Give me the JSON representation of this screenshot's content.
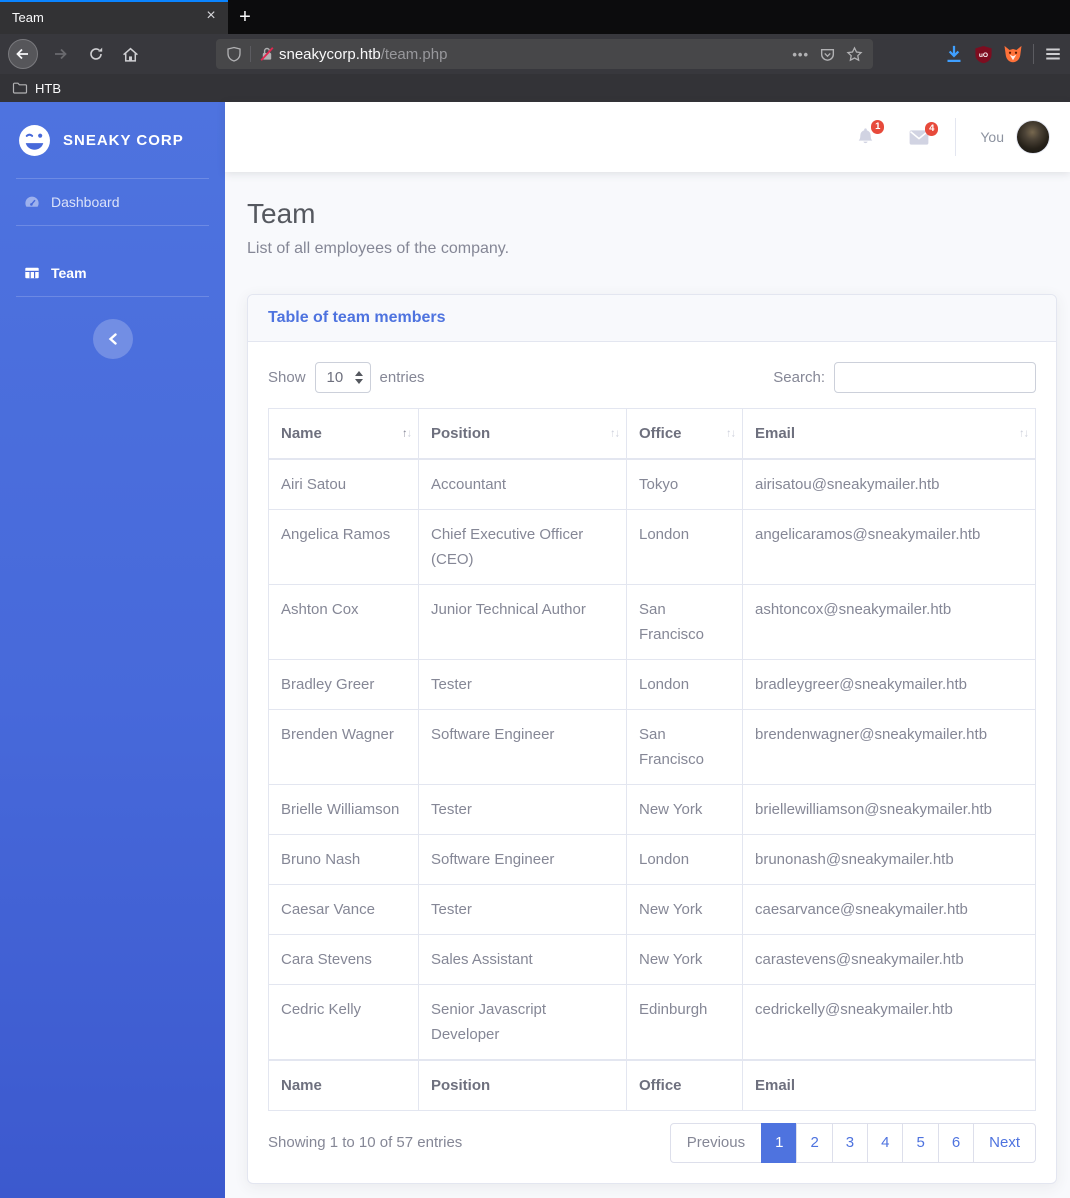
{
  "colors": {
    "primary": "#4e73df",
    "badge": "#e74a3b",
    "tab_accent": "#0a84ff"
  },
  "browser": {
    "tab_title": "Team",
    "close_glyph": "×",
    "new_tab_glyph": "+",
    "url_host": "sneakycorp.htb",
    "url_path": "/team.php",
    "page_actions_glyph": "•••",
    "bookmark_label": "HTB",
    "icons": [
      "back-icon",
      "forward-icon",
      "reload-icon",
      "home-icon",
      "shield-icon",
      "insecure-lock-icon",
      "pocket-icon",
      "bookmark-star-icon",
      "download-icon",
      "ublock-icon",
      "foxyproxy-icon",
      "menu-icon",
      "folder-icon"
    ]
  },
  "sidebar": {
    "brand": "SNEAKY CORP",
    "items": [
      {
        "label": "Dashboard",
        "icon": "dashboard-icon",
        "active": false
      },
      {
        "label": "Team",
        "icon": "table-icon",
        "active": true
      }
    ]
  },
  "topbar": {
    "alerts_badge": "1",
    "messages_badge": "4",
    "user_label": "You"
  },
  "page": {
    "heading": "Team",
    "subheading": "List of all employees of the company."
  },
  "card": {
    "title": "Table of team members",
    "length_control": {
      "show_label": "Show",
      "entries_label": "entries",
      "value": "10"
    },
    "search": {
      "label": "Search:",
      "value": ""
    },
    "table": {
      "columns": [
        "Name",
        "Position",
        "Office",
        "Email"
      ],
      "sorted_column": "Name",
      "sorted_dir": "asc",
      "sort_asc_glyph": "↑",
      "sort_desc_glyph": "↓",
      "rows": [
        [
          "Airi Satou",
          "Accountant",
          "Tokyo",
          "airisatou@sneakymailer.htb"
        ],
        [
          "Angelica Ramos",
          "Chief Executive Officer (CEO)",
          "London",
          "angelicaramos@sneakymailer.htb"
        ],
        [
          "Ashton Cox",
          "Junior Technical Author",
          "San Francisco",
          "ashtoncox@sneakymailer.htb"
        ],
        [
          "Bradley Greer",
          "Tester",
          "London",
          "bradleygreer@sneakymailer.htb"
        ],
        [
          "Brenden Wagner",
          "Software Engineer",
          "San Francisco",
          "brendenwagner@sneakymailer.htb"
        ],
        [
          "Brielle Williamson",
          "Tester",
          "New York",
          "briellewilliamson@sneakymailer.htb"
        ],
        [
          "Bruno Nash",
          "Software Engineer",
          "London",
          "brunonash@sneakymailer.htb"
        ],
        [
          "Caesar Vance",
          "Tester",
          "New York",
          "caesarvance@sneakymailer.htb"
        ],
        [
          "Cara Stevens",
          "Sales Assistant",
          "New York",
          "carastevens@sneakymailer.htb"
        ],
        [
          "Cedric Kelly",
          "Senior Javascript Developer",
          "Edinburgh",
          "cedrickelly@sneakymailer.htb"
        ]
      ]
    },
    "info": "Showing 1 to 10 of 57 entries",
    "pagination": {
      "previous": "Previous",
      "pages": [
        "1",
        "2",
        "3",
        "4",
        "5",
        "6"
      ],
      "active_page": "1",
      "next": "Next"
    }
  }
}
